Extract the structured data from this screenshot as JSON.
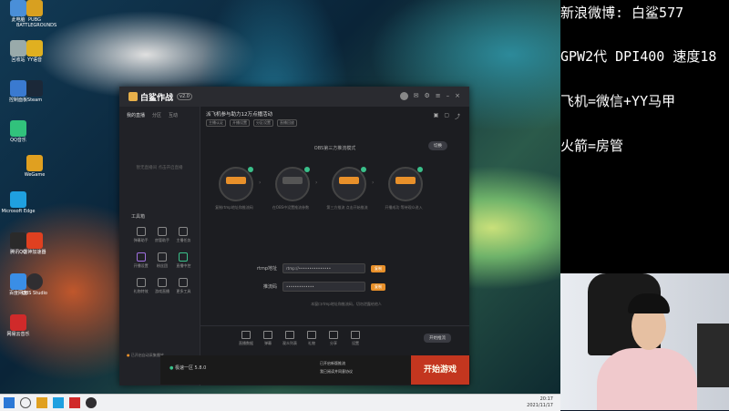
{
  "overlay": {
    "line1": "新浪微博: 白鲨577",
    "line2": "GPW2代 DPI400 速度18",
    "line3": "飞机=微信+YY马甲",
    "line4": "火箭=房管"
  },
  "desktop_icons": [
    {
      "label": "此电脑",
      "color": "#4a8fd8"
    },
    {
      "label": "回收站",
      "color": "#9aa"
    },
    {
      "label": "控制面板",
      "color": "#3a7ad0"
    },
    {
      "label": "QQ音乐",
      "color": "#31c27c"
    },
    {
      "label": "Microsoft Edge",
      "color": "#1fa0e0"
    },
    {
      "label": "腾讯QQ",
      "color": "#2a2a2a"
    },
    {
      "label": "百度网盘",
      "color": "#3a8ee6"
    },
    {
      "label": "网易云音乐",
      "color": "#d02a2a"
    },
    {
      "label": "PUBG BATTLEGROUNDS",
      "color": "#d8a020"
    },
    {
      "label": "YY语音",
      "color": "#e0b020"
    },
    {
      "label": "Steam",
      "color": "#1b2838"
    },
    {
      "label": "WeGame",
      "color": "#e0a020"
    },
    {
      "label": "雷神加速器",
      "color": "#e04020"
    },
    {
      "label": "OBS Studio",
      "color": "#302e31"
    }
  ],
  "app": {
    "name": "白鲨作战",
    "version": "v2.0",
    "left_tabs": [
      "我的直播",
      "分区",
      "互动"
    ],
    "empty_text": "暂无直播间 点击开启直播",
    "tools_title": "工具箱",
    "tools": [
      "弹幕助手",
      "房管助手",
      "主播任务",
      "开播设置",
      "粉丝团",
      "直播中控",
      "礼物特效",
      "游戏直播",
      "更多工具"
    ],
    "bottom_note": "已开启自动采集播放",
    "subhead": "派飞机参与助力12万点播活动",
    "tags": [
      "主播认证",
      "开播设置",
      "分区设置",
      "直播回放"
    ],
    "mode_title": "OBS第三方推流模式",
    "switch_btn": "切换",
    "steps": [
      {
        "caption": "复制rtmp地址和推流码"
      },
      {
        "caption": "在OBS中设置推流参数"
      },
      {
        "caption": "第三方推流 点击开始推流"
      },
      {
        "caption": "开播成功 等待观众进入"
      }
    ],
    "rtmp_label": "rtmp地址",
    "rtmp_value": "rtmp://•••••••••••••••",
    "key_label": "推流码",
    "key_value": "•••••••••••••",
    "copy_label": "复制",
    "hint": "本窗口rtmp地址和推流码，切勿泄露给他人",
    "bar_buttons": [
      "直播数据",
      "弹幕",
      "观众列表",
      "礼物",
      "分享",
      "设置"
    ],
    "go_label": "开始推流",
    "footer": "白鲨作战 v2.0"
  },
  "game": {
    "option_text": "极速一区 5.8.0",
    "mid_line1": "已开启新版推流",
    "mid_line2": "我已阅读并同意协议",
    "start_label": "开始游戏"
  },
  "taskbar": {
    "time": "20:17",
    "date": "2021/11/17"
  }
}
